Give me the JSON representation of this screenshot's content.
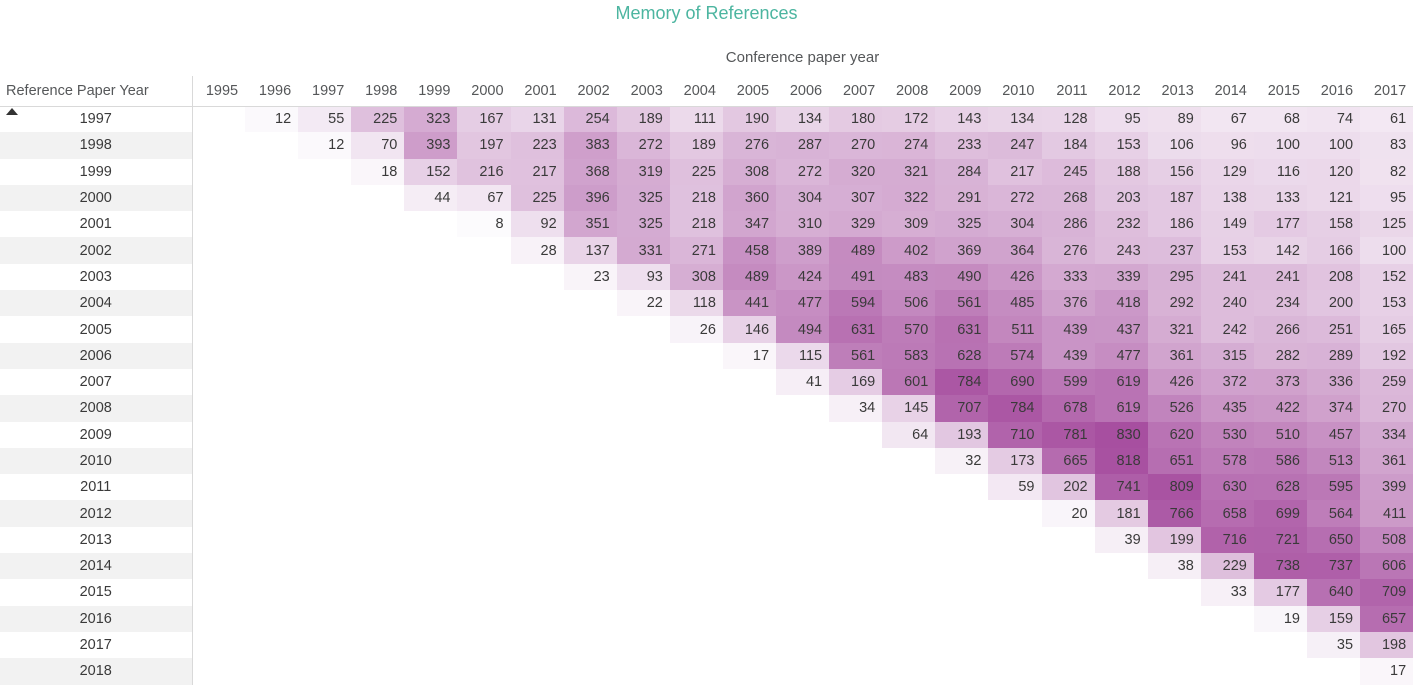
{
  "title": "Memory of References",
  "column_axis_title": "Conference paper year",
  "row_header_label": "Reference Paper Year",
  "colors": {
    "title": "#4cb5a0",
    "axis_title": "#555759",
    "heat_min": "#ffffff",
    "heat_max": "#a74fa0",
    "row_stripe": "#f2f2f2",
    "grid_line": "#d9d9d9",
    "text": "#3a3a3a"
  },
  "sort": {
    "column": "Reference Paper Year",
    "direction": "ascending",
    "icon": "sort-ascending-caret-icon"
  },
  "chart_data": {
    "type": "heatmap",
    "title": "Memory of References",
    "xlabel": "Conference paper year",
    "ylabel": "Reference Paper Year",
    "grid": false,
    "legend": "none",
    "vmin": 8,
    "vmax": 830,
    "x": [
      "1995",
      "1996",
      "1997",
      "1998",
      "1999",
      "2000",
      "2001",
      "2002",
      "2003",
      "2004",
      "2005",
      "2006",
      "2007",
      "2008",
      "2009",
      "2010",
      "2011",
      "2012",
      "2013",
      "2014",
      "2015",
      "2016",
      "2017"
    ],
    "y": [
      "1997",
      "1998",
      "1999",
      "2000",
      "2001",
      "2002",
      "2003",
      "2004",
      "2005",
      "2006",
      "2007",
      "2008",
      "2009",
      "2010",
      "2011",
      "2012",
      "2013",
      "2014",
      "2015",
      "2016",
      "2017",
      "2018"
    ],
    "values": [
      [
        null,
        12,
        55,
        225,
        323,
        167,
        131,
        254,
        189,
        111,
        190,
        134,
        180,
        172,
        143,
        134,
        128,
        95,
        89,
        67,
        68,
        74,
        61
      ],
      [
        null,
        null,
        12,
        70,
        393,
        197,
        223,
        383,
        272,
        189,
        276,
        287,
        270,
        274,
        233,
        247,
        184,
        153,
        106,
        96,
        100,
        100,
        83
      ],
      [
        null,
        null,
        null,
        18,
        152,
        216,
        217,
        368,
        319,
        225,
        308,
        272,
        320,
        321,
        284,
        217,
        245,
        188,
        156,
        129,
        116,
        120,
        82
      ],
      [
        null,
        null,
        null,
        null,
        44,
        67,
        225,
        396,
        325,
        218,
        360,
        304,
        307,
        322,
        291,
        272,
        268,
        203,
        187,
        138,
        133,
        121,
        95
      ],
      [
        null,
        null,
        null,
        null,
        null,
        8,
        92,
        351,
        325,
        218,
        347,
        310,
        329,
        309,
        325,
        304,
        286,
        232,
        186,
        149,
        177,
        158,
        125
      ],
      [
        null,
        null,
        null,
        null,
        null,
        null,
        28,
        137,
        331,
        271,
        458,
        389,
        489,
        402,
        369,
        364,
        276,
        243,
        237,
        153,
        142,
        166,
        100
      ],
      [
        null,
        null,
        null,
        null,
        null,
        null,
        null,
        23,
        93,
        308,
        489,
        424,
        491,
        483,
        490,
        426,
        333,
        339,
        295,
        241,
        241,
        208,
        152
      ],
      [
        null,
        null,
        null,
        null,
        null,
        null,
        null,
        null,
        22,
        118,
        441,
        477,
        594,
        506,
        561,
        485,
        376,
        418,
        292,
        240,
        234,
        200,
        153
      ],
      [
        null,
        null,
        null,
        null,
        null,
        null,
        null,
        null,
        null,
        26,
        146,
        494,
        631,
        570,
        631,
        511,
        439,
        437,
        321,
        242,
        266,
        251,
        165
      ],
      [
        null,
        null,
        null,
        null,
        null,
        null,
        null,
        null,
        null,
        null,
        17,
        115,
        561,
        583,
        628,
        574,
        439,
        477,
        361,
        315,
        282,
        289,
        192
      ],
      [
        null,
        null,
        null,
        null,
        null,
        null,
        null,
        null,
        null,
        null,
        null,
        41,
        169,
        601,
        784,
        690,
        599,
        619,
        426,
        372,
        373,
        336,
        259
      ],
      [
        null,
        null,
        null,
        null,
        null,
        null,
        null,
        null,
        null,
        null,
        null,
        null,
        34,
        145,
        707,
        784,
        678,
        619,
        526,
        435,
        422,
        374,
        270
      ],
      [
        null,
        null,
        null,
        null,
        null,
        null,
        null,
        null,
        null,
        null,
        null,
        null,
        null,
        64,
        193,
        710,
        781,
        830,
        620,
        530,
        510,
        457,
        334
      ],
      [
        null,
        null,
        null,
        null,
        null,
        null,
        null,
        null,
        null,
        null,
        null,
        null,
        null,
        null,
        32,
        173,
        665,
        818,
        651,
        578,
        586,
        513,
        361
      ],
      [
        null,
        null,
        null,
        null,
        null,
        null,
        null,
        null,
        null,
        null,
        null,
        null,
        null,
        null,
        null,
        59,
        202,
        741,
        809,
        630,
        628,
        595,
        399
      ],
      [
        null,
        null,
        null,
        null,
        null,
        null,
        null,
        null,
        null,
        null,
        null,
        null,
        null,
        null,
        null,
        null,
        20,
        181,
        766,
        658,
        699,
        564,
        411
      ],
      [
        null,
        null,
        null,
        null,
        null,
        null,
        null,
        null,
        null,
        null,
        null,
        null,
        null,
        null,
        null,
        null,
        null,
        39,
        199,
        716,
        721,
        650,
        508
      ],
      [
        null,
        null,
        null,
        null,
        null,
        null,
        null,
        null,
        null,
        null,
        null,
        null,
        null,
        null,
        null,
        null,
        null,
        null,
        38,
        229,
        738,
        737,
        606
      ],
      [
        null,
        null,
        null,
        null,
        null,
        null,
        null,
        null,
        null,
        null,
        null,
        null,
        null,
        null,
        null,
        null,
        null,
        null,
        null,
        33,
        177,
        640,
        709
      ],
      [
        null,
        null,
        null,
        null,
        null,
        null,
        null,
        null,
        null,
        null,
        null,
        null,
        null,
        null,
        null,
        null,
        null,
        null,
        null,
        null,
        19,
        159,
        657
      ],
      [
        null,
        null,
        null,
        null,
        null,
        null,
        null,
        null,
        null,
        null,
        null,
        null,
        null,
        null,
        null,
        null,
        null,
        null,
        null,
        null,
        null,
        35,
        198
      ],
      [
        null,
        null,
        null,
        null,
        null,
        null,
        null,
        null,
        null,
        null,
        null,
        null,
        null,
        null,
        null,
        null,
        null,
        null,
        null,
        null,
        null,
        null,
        17
      ]
    ]
  }
}
